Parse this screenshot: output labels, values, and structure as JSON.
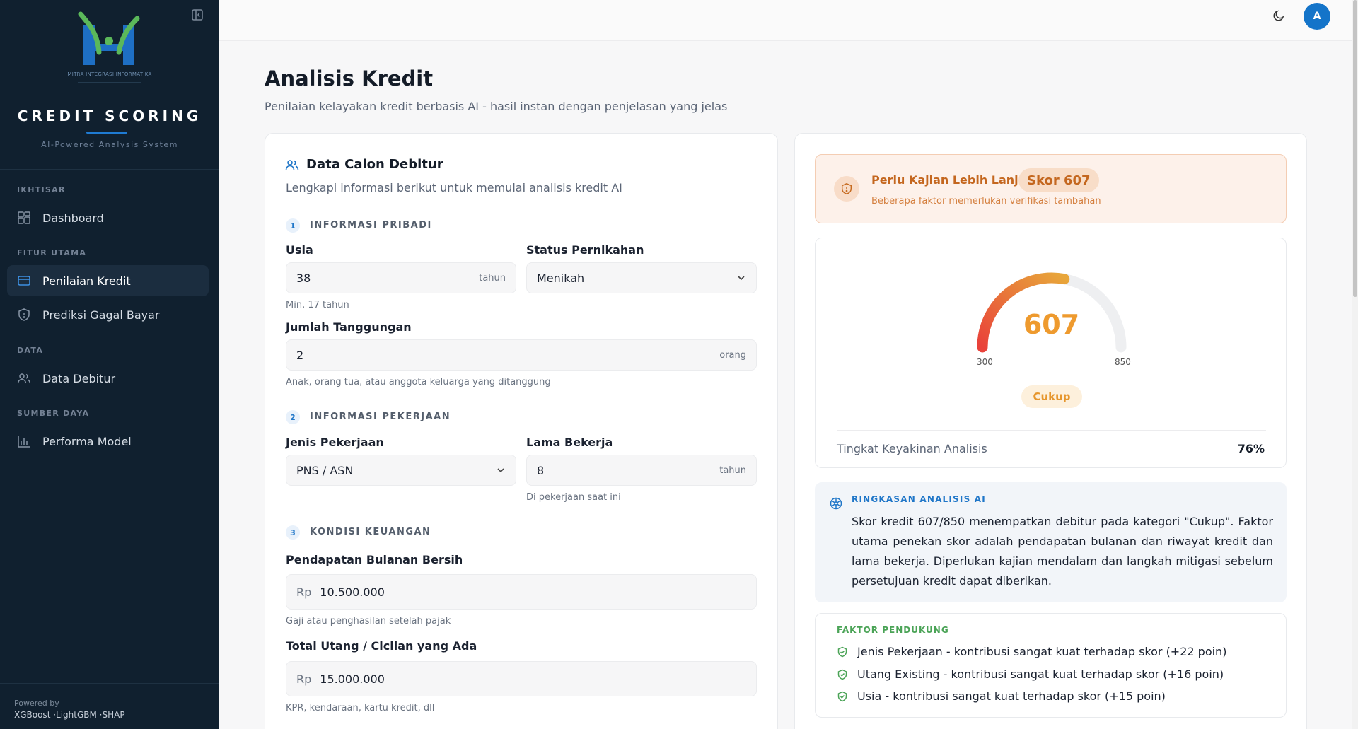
{
  "sidebar": {
    "logo_tagline": "MITRA INTEGRASI INFORMATIKA",
    "brand": "CREDIT SCORING",
    "brand_sub": "AI-Powered Analysis System",
    "sections": [
      {
        "title": "IKHTISAR",
        "items": [
          {
            "label": "Dashboard",
            "icon": "dashboard-icon"
          }
        ]
      },
      {
        "title": "FITUR UTAMA",
        "items": [
          {
            "label": "Penilaian Kredit",
            "icon": "credit-card-icon",
            "active": true
          },
          {
            "label": "Prediksi Gagal Bayar",
            "icon": "shield-icon"
          }
        ]
      },
      {
        "title": "DATA",
        "items": [
          {
            "label": "Data Debitur",
            "icon": "users-icon"
          }
        ]
      },
      {
        "title": "SUMBER DAYA",
        "items": [
          {
            "label": "Performa Model",
            "icon": "bar-chart-icon"
          }
        ]
      }
    ],
    "powered_by": "Powered by",
    "powered_stack": "XGBoost ·LightGBM ·SHAP"
  },
  "topbar": {
    "avatar_initial": "A"
  },
  "page": {
    "title": "Analisis Kredit",
    "subtitle": "Penilaian kelayakan kredit berbasis AI - hasil instan dengan penjelasan yang jelas"
  },
  "form": {
    "title": "Data Calon Debitur",
    "desc": "Lengkapi informasi berikut untuk memulai analisis kredit AI",
    "step1": {
      "num": "1",
      "label": "INFORMASI PRIBADI"
    },
    "usia": {
      "label": "Usia",
      "value": "38",
      "suffix": "tahun",
      "hint": "Min. 17 tahun"
    },
    "status": {
      "label": "Status Pernikahan",
      "value": "Menikah"
    },
    "tanggungan": {
      "label": "Jumlah Tanggungan",
      "value": "2",
      "suffix": "orang",
      "hint": "Anak, orang tua, atau anggota keluarga yang ditanggung"
    },
    "step2": {
      "num": "2",
      "label": "INFORMASI PEKERJAAN"
    },
    "pekerjaan": {
      "label": "Jenis Pekerjaan",
      "value": "PNS / ASN"
    },
    "lama": {
      "label": "Lama Bekerja",
      "value": "8",
      "suffix": "tahun",
      "hint": "Di pekerjaan saat ini"
    },
    "step3": {
      "num": "3",
      "label": "KONDISI KEUANGAN"
    },
    "pendapatan": {
      "label": "Pendapatan Bulanan Bersih",
      "prefix": "Rp",
      "value": "10.500.000",
      "hint": "Gaji atau penghasilan setelah pajak"
    },
    "utang": {
      "label": "Total Utang / Cicilan yang Ada",
      "prefix": "Rp",
      "value": "15.000.000",
      "hint": "KPR, kendaraan, kartu kredit, dll"
    }
  },
  "result": {
    "alert": {
      "title": "Perlu Kajian Lebih Lanjut",
      "badge": "Skor 607",
      "subtitle": "Beberapa faktor memerlukan verifikasi tambahan"
    },
    "gauge": {
      "score": "607",
      "score_value": 607,
      "min": "300",
      "max": "850",
      "min_value": 300,
      "max_value": 850,
      "category": "Cukup"
    },
    "confidence_label": "Tingkat Keyakinan Analisis",
    "confidence_value": "76%",
    "summary_title": "RINGKASAN ANALISIS AI",
    "summary_text": "Skor kredit 607/850 menempatkan debitur pada kategori \"Cukup\". Faktor utama penekan skor adalah pendapatan bulanan dan riwayat kredit dan lama bekerja. Diperlukan kajian mendalam dan langkah mitigasi sebelum persetujuan kredit dapat diberikan.",
    "factors_title": "FAKTOR PENDUKUNG",
    "factors": [
      "Jenis Pekerjaan - kontribusi sangat kuat terhadap skor (+22 poin)",
      "Utang Existing - kontribusi sangat kuat terhadap skor (+16 poin)",
      "Usia - kontribusi sangat kuat terhadap skor (+15 poin)"
    ]
  },
  "colors": {
    "primary": "#1f76c8",
    "sidebar_bg": "#10202f",
    "warning": "#c4671f",
    "score": "#ee9a2e",
    "success": "#4aa356"
  }
}
